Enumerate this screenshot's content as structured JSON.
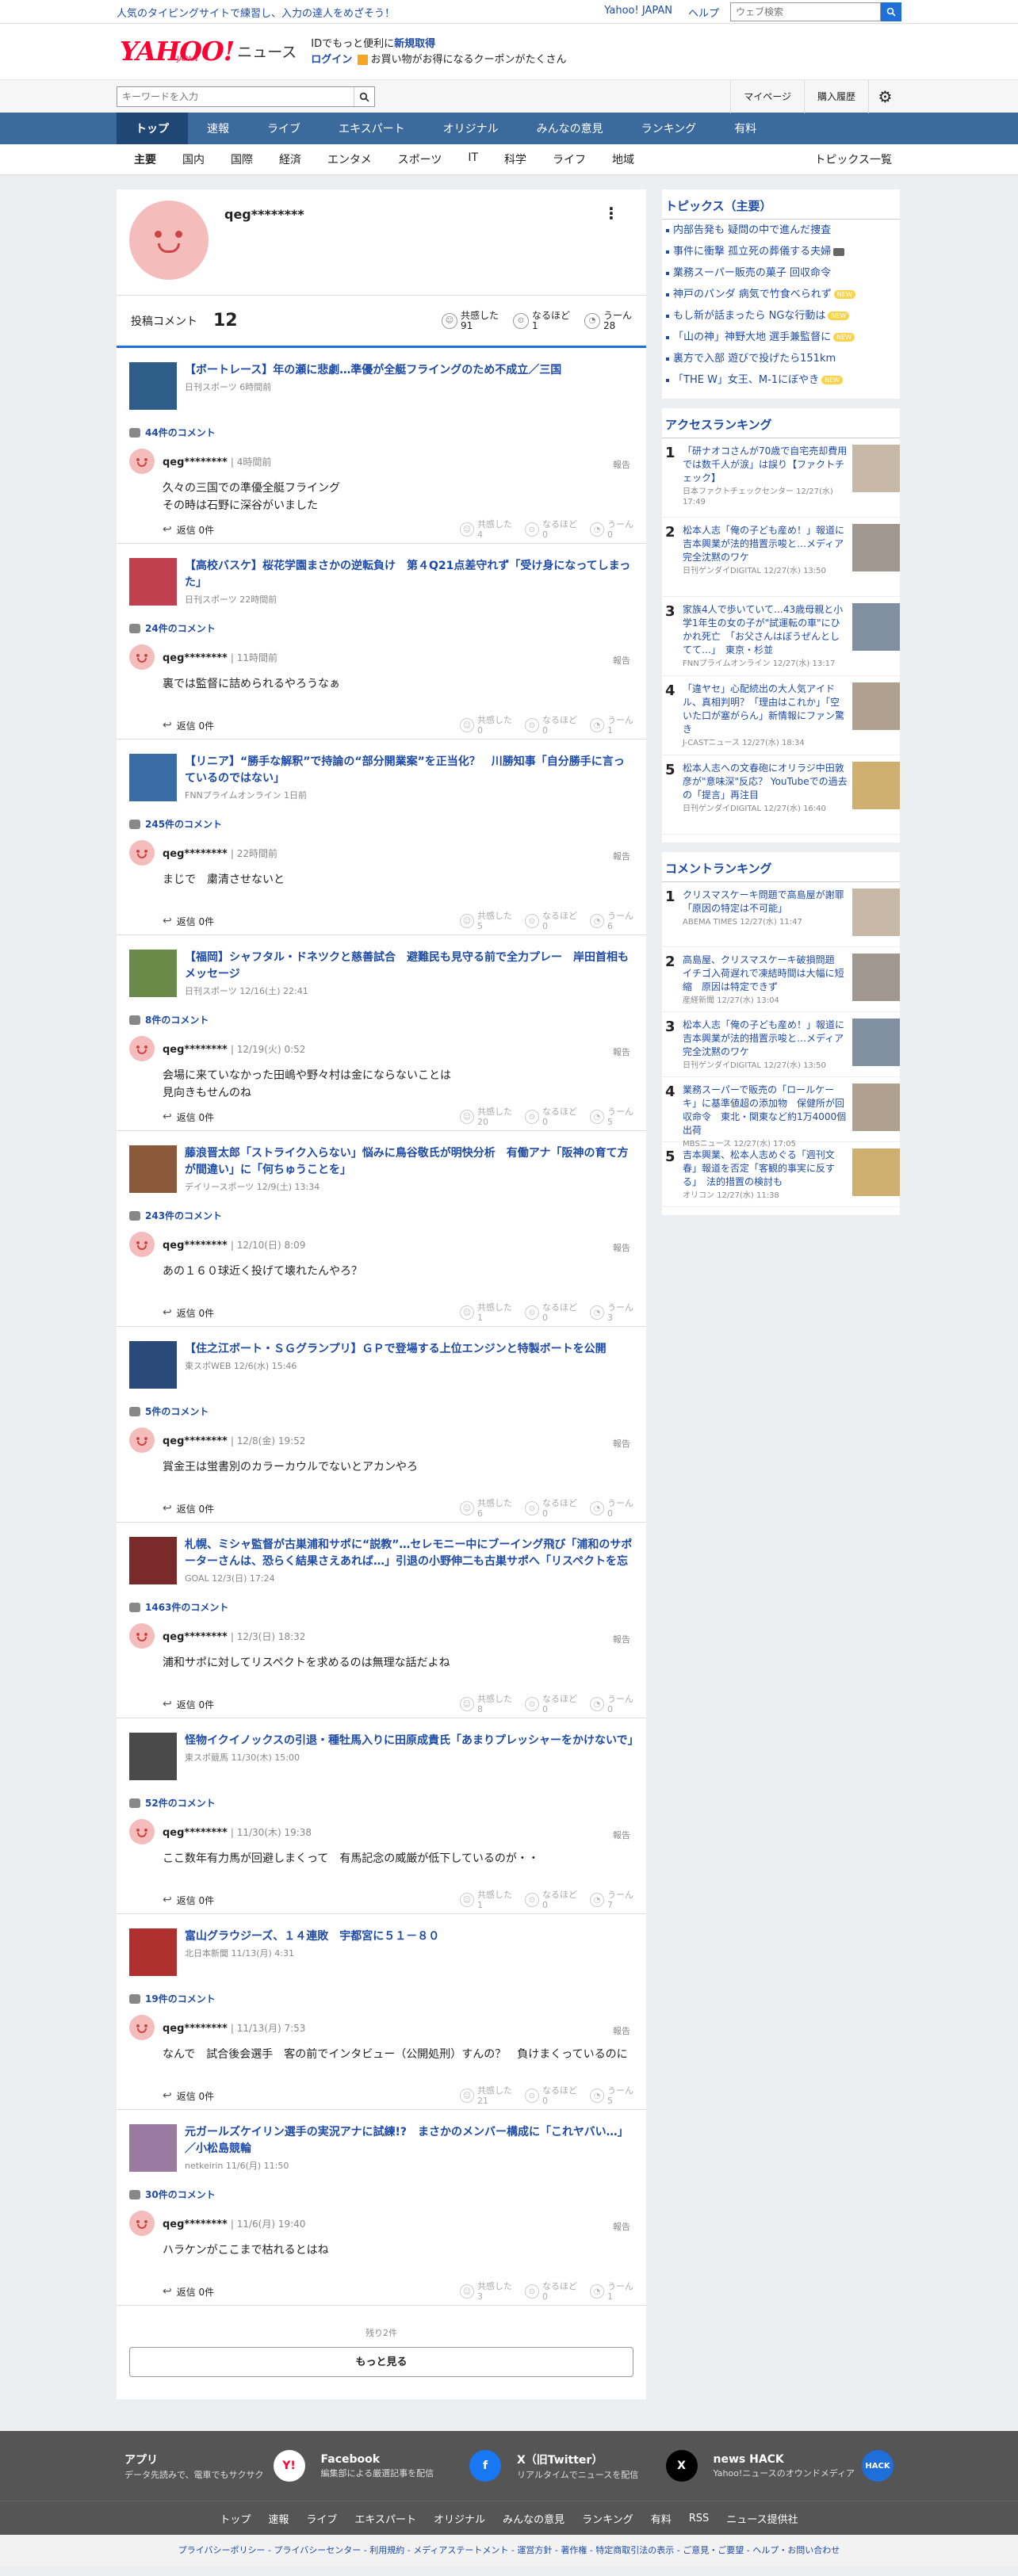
{
  "topbar": {
    "promo": "人気のタイピングサイトで練習し、入力の達人をめざそう！",
    "links": [
      "Yahoo! JAPAN",
      "ヘルプ"
    ],
    "search_placeholder": "ウェブ検索"
  },
  "mast": {
    "logo": "YAHOO!",
    "logo_sub": "JAPAN",
    "news": "ニュース",
    "line1_a": "IDでもっと便利に",
    "line1_b": "新規取得",
    "line2_a": "ログイン",
    "line2_b": "お買い物がお得になるクーポンがたくさん"
  },
  "search": {
    "placeholder": "キーワードを入力",
    "mypage": "マイページ",
    "purchase": "購入履歴"
  },
  "nav": [
    "トップ",
    "速報",
    "ライブ",
    "エキスパート",
    "オリジナル",
    "みんなの意見",
    "ランキング",
    "有料"
  ],
  "subnav": {
    "cats": [
      "主要",
      "国内",
      "国際",
      "経済",
      "エンタメ",
      "スポーツ",
      "IT",
      "科学",
      "ライフ",
      "地域"
    ],
    "all": "トピックス一覧"
  },
  "profile": {
    "name": "qeg********",
    "count_label": "投稿コメント",
    "count": "12",
    "reactions": [
      {
        "label": "共感した",
        "value": "91"
      },
      {
        "label": "なるほど",
        "value": "1"
      },
      {
        "label": "うーん",
        "value": "28"
      }
    ]
  },
  "labels": {
    "reply": "返信 0件",
    "report": "報告",
    "empathy": "共感した",
    "indeed": "なるほど",
    "hmm": "うーん",
    "remaining": "残り2件",
    "more": "もっと見る"
  },
  "items": [
    {
      "title": "【ボートレース】年の瀬に悲劇…準優が全艇フライングのため不成立／三国",
      "src": "日刊スポーツ 6時間前",
      "count": "44件のコメント",
      "user": "qeg********",
      "time": "4時間前",
      "text": "久々の三国での準優全艇フライング\nその時は石野に深谷がいました",
      "r": [
        "4",
        "0",
        "0"
      ]
    },
    {
      "title": "【高校バスケ】桜花学園まさかの逆転負け　第４Q21点差守れず「受け身になってしまった」",
      "src": "日刊スポーツ 22時間前",
      "count": "24件のコメント",
      "user": "qeg********",
      "time": "11時間前",
      "text": "裏では監督に詰められるやろうなぁ",
      "r": [
        "0",
        "0",
        "1"
      ]
    },
    {
      "title": "【リニア】“勝手な解釈”で持論の“部分開業案”を正当化？　川勝知事「自分勝手に言っているのではない」",
      "src": "FNNプライムオンライン 1日前",
      "count": "245件のコメント",
      "user": "qeg********",
      "time": "22時間前",
      "text": "まじで　粛清させないと",
      "r": [
        "5",
        "0",
        "6"
      ]
    },
    {
      "title": "【福岡】シャフタル・ドネツクと慈善試合　避難民も見守る前で全力プレー　岸田首相もメッセージ",
      "src": "日刊スポーツ 12/16(土) 22:41",
      "count": "8件のコメント",
      "user": "qeg********",
      "time": "12/19(火) 0:52",
      "text": "会場に来ていなかった田嶋や野々村は金にならないことは\n見向きもせんのね",
      "r": [
        "20",
        "0",
        "5"
      ]
    },
    {
      "title": "藤浪晋太郎「ストライク入らない」悩みに鳥谷敬氏が明快分析　有働アナ「阪神の育て方が間違い」に「何ちゅうことを」",
      "src": "デイリースポーツ 12/9(土) 13:34",
      "count": "243件のコメント",
      "user": "qeg********",
      "time": "12/10(日) 8:09",
      "text": "あの１６０球近く投げて壊れたんやろ？",
      "r": [
        "1",
        "0",
        "3"
      ]
    },
    {
      "title": "【住之江ボート・ＳＧグランプリ】ＧＰで登場する上位エンジンと特製ボートを公開",
      "src": "東スポWEB 12/6(水) 15:46",
      "count": "5件のコメント",
      "user": "qeg********",
      "time": "12/8(金) 19:52",
      "text": "賞金王は蛍書別のカラーカウルでないとアカンやろ",
      "r": [
        "6",
        "0",
        "0"
      ]
    },
    {
      "title": "札幌、ミシャ監督が古巣浦和サポに“説教”…セレモニー中にブーイング飛び「浦和のサポーターさんは、恐らく結果さえあれば…」引退の小野伸二も古巣サポへ「リスペクトを忘れないで」",
      "src": "GOAL 12/3(日) 17:24",
      "count": "1463件のコメント",
      "user": "qeg********",
      "time": "12/3(日) 18:32",
      "text": "浦和サポに対してリスペクトを求めるのは無理な話だよね",
      "r": [
        "8",
        "0",
        "0"
      ]
    },
    {
      "title": "怪物イクイノックスの引退・種牡馬入りに田原成貴氏「あまりプレッシャーをかけないで」",
      "src": "東スポ競馬 11/30(木) 15:00",
      "count": "52件のコメント",
      "user": "qeg********",
      "time": "11/30(木) 19:38",
      "text": "ここ数年有力馬が回避しまくって　有馬記念の威厳が低下しているのが・・",
      "r": [
        "1",
        "0",
        "7"
      ]
    },
    {
      "title": "富山グラウジーズ、１４連敗　宇都宮に５１－８０",
      "src": "北日本新聞 11/13(月) 4:31",
      "count": "19件のコメント",
      "user": "qeg********",
      "time": "11/13(月) 7:53",
      "text": "なんで　試合後会選手　客の前でインタビュー（公開処刑）すんの？　負けまくっているのに",
      "r": [
        "21",
        "0",
        "5"
      ]
    },
    {
      "title": "元ガールズケイリン選手の実況アナに試練!?　まさかのメンバー構成に「これヤバい…」／小松島競輪",
      "src": "netkeirin 11/6(月) 11:50",
      "count": "30件のコメント",
      "user": "qeg********",
      "time": "11/6(月) 19:40",
      "text": "ハラケンがここまで枯れるとはね",
      "r": [
        "3",
        "0",
        "1"
      ]
    }
  ],
  "thumb_colors": [
    "#2f5d8a",
    "#c04050",
    "#3a6da5",
    "#6a8a4a",
    "#8a5a3a",
    "#2a4a7a",
    "#7a2a2a",
    "#4a4a4a",
    "#b03030",
    "#9a7aa0"
  ],
  "side": {
    "topics_title": "トピックス（主要）",
    "topics": [
      {
        "t": "内部告発も 疑問の中で進んだ捜査",
        "b": ""
      },
      {
        "t": "事件に衝撃 孤立死の葬儀する夫婦",
        "b": "cam"
      },
      {
        "t": "業務スーパー販売の菓子 回収命令",
        "b": ""
      },
      {
        "t": "神戸のパンダ 病気で竹食べられず",
        "b": "NEW"
      },
      {
        "t": "もし新が話まったら NGな行動は",
        "b": "NEW"
      },
      {
        "t": "「山の神」神野大地 選手兼監督に",
        "b": "NEW"
      },
      {
        "t": "裏方で入部 遊びで投げたら151km",
        "b": ""
      },
      {
        "t": "「THE W」女王、M-1にぼやき",
        "b": "NEW"
      }
    ],
    "access_title": "アクセスランキング",
    "access": [
      {
        "n": "1",
        "t": "「研ナオコさんが70歳で自宅売却費用では数千人が涙」は誤り【ファクトチェック】",
        "m": "日本ファクトチェックセンター 12/27(水) 17:49"
      },
      {
        "n": "2",
        "t": "松本人志「俺の子ども産め！」報道に吉本興業が法的措置示唆と…メディア完全沈黙のワケ",
        "m": "日刊ゲンダイDIGITAL 12/27(水) 13:50"
      },
      {
        "n": "3",
        "t": "家族4人で歩いていて…43歳母親と小学1年生の女の子が\"試運転の車\"にひかれ死亡　「お父さんはぼうぜんとしてて…」　東京・杉並",
        "m": "FNNプライムオンライン 12/27(水) 13:17"
      },
      {
        "n": "4",
        "t": "「違ヤセ」心配続出の大人気アイドル、真相判明？「理由はこれか」「空いた口が塞がらん」新情報にファン驚き",
        "m": "J-CASTニュース 12/27(水) 18:34"
      },
      {
        "n": "5",
        "t": "松本人志への文春砲にオリラジ中田敦彦が\"意味深\"反応？ YouTubeでの過去の「提言」再注目",
        "m": "日刊ゲンダイDIGITAL 12/27(水) 16:40"
      }
    ],
    "comment_title": "コメントランキング",
    "comment": [
      {
        "n": "1",
        "t": "クリスマスケーキ問題で高島屋が謝罪「原因の特定は不可能」",
        "m": "ABEMA TIMES 12/27(水) 11:47"
      },
      {
        "n": "2",
        "t": "高島屋、クリスマスケーキ破損問題　イチゴ入荷遅れで凍結時間は大幅に短縮　原因は特定できず",
        "m": "産経新聞 12/27(水) 13:04"
      },
      {
        "n": "3",
        "t": "松本人志「俺の子ども産め！」報道に吉本興業が法的措置示唆と…メディア完全沈黙のワケ",
        "m": "日刊ゲンダイDIGITAL 12/27(水) 13:50"
      },
      {
        "n": "4",
        "t": "業務スーパーで販売の「ロールケーキ」に基準値超の添加物　保健所が回収命令　東北・関東など約1万4000個出荷",
        "m": "MBSニュース 12/27(水) 17:05"
      },
      {
        "n": "5",
        "t": "吉本興業、松本人志めぐる「週刊文春」報道を否定「客観的事実に反する」　法的措置の検討も",
        "m": "オリコン 12/27(水) 11:38"
      }
    ]
  },
  "apps": [
    {
      "nm": "アプリ",
      "ds": "データ先読みで、電車でもサクサク",
      "ic": "Y!"
    },
    {
      "nm": "Facebook",
      "ds": "編集部による厳選記事を配信",
      "ic": "f"
    },
    {
      "nm": "X（旧Twitter）",
      "ds": "リアルタイムでニュースを配信",
      "ic": "X"
    },
    {
      "nm": "news HACK",
      "ds": "Yahoo!ニュースのオウンドメディア",
      "ic": "HACK"
    }
  ],
  "fnav": [
    "トップ",
    "速報",
    "ライブ",
    "エキスパート",
    "オリジナル",
    "みんなの意見",
    "ランキング",
    "有料",
    "RSS",
    "ニュース提供社"
  ],
  "flinks": "プライバシーポリシー - プライバシーセンター - 利用規約 - メディアステートメント - 運営方針 - 著作権 - 特定商取引法の表示 - ご意見・ご要望 - ヘルプ・お問い合わせ"
}
